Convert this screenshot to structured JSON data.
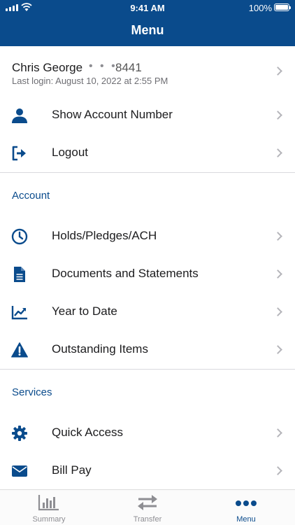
{
  "status_bar": {
    "time": "9:41 AM",
    "battery": "100%"
  },
  "header": {
    "title": "Menu"
  },
  "user": {
    "name": "Chris George",
    "masked": "• • •",
    "account_suffix": "8441",
    "last_login": "Last login: August 10, 2022 at 2:55 PM"
  },
  "top_items": [
    {
      "label": "Show Account Number",
      "icon": "person-icon"
    },
    {
      "label": "Logout",
      "icon": "logout-icon"
    }
  ],
  "sections": [
    {
      "title": "Account",
      "items": [
        {
          "label": "Holds/Pledges/ACH",
          "icon": "clock-icon"
        },
        {
          "label": "Documents and Statements",
          "icon": "document-icon"
        },
        {
          "label": "Year to Date",
          "icon": "trend-chart-icon"
        },
        {
          "label": "Outstanding Items",
          "icon": "warning-icon"
        }
      ]
    },
    {
      "title": "Services",
      "items": [
        {
          "label": "Quick Access",
          "icon": "gear-icon"
        },
        {
          "label": "Bill Pay",
          "icon": "envelope-icon"
        }
      ]
    }
  ],
  "tabs": [
    {
      "label": "Summary",
      "icon": "bar-chart-icon",
      "active": false
    },
    {
      "label": "Transfer",
      "icon": "transfer-arrows-icon",
      "active": false
    },
    {
      "label": "Menu",
      "icon": "more-dots-icon",
      "active": true
    }
  ],
  "colors": {
    "brand": "#0a4b8c",
    "text": "#1c1c1e",
    "muted": "#8e8e93",
    "chevron": "#b5b5ba"
  }
}
